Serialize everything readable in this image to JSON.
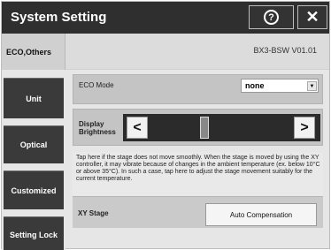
{
  "window": {
    "title": "System Setting"
  },
  "titlebar": {
    "help_label": "?",
    "close_label": "✕"
  },
  "tabs": {
    "active": "ECO,Others"
  },
  "model": "BX3-BSW  V01.01",
  "sidebar": {
    "items": [
      {
        "label": "Unit"
      },
      {
        "label": "Optical"
      },
      {
        "label": "Customized"
      },
      {
        "label": "Setting Lock"
      }
    ]
  },
  "eco_mode": {
    "label": "ECO Mode",
    "value": "none",
    "arrow": "▼"
  },
  "display_brightness": {
    "label": "Display Brightness",
    "left": "<",
    "right": ">",
    "level": 0.37
  },
  "stage_notice": "Tap here if the stage does not move smoothly. When the stage is moved by using the XY controller, it may vibrate because of changes in the ambient temperature (ex. below 10°C or above 35°C). In such a case, tap here to adjust the stage movement suitably for the current temperature.",
  "xy_stage": {
    "label": "XY Stage",
    "button": "Auto Compensation"
  }
}
